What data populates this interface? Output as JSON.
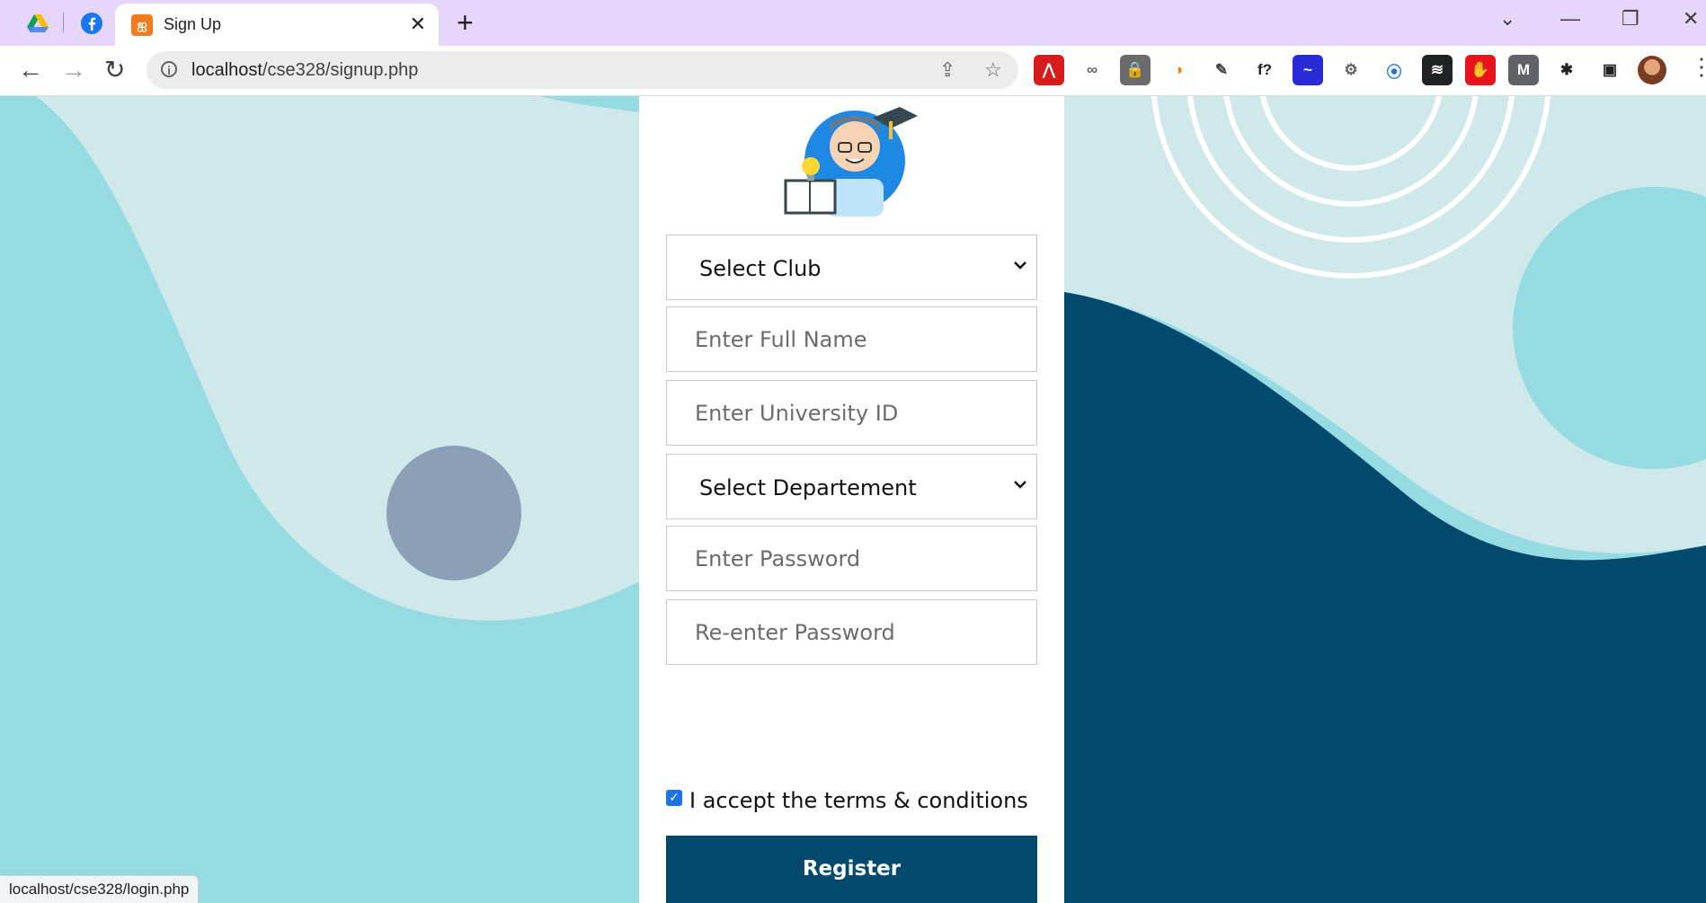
{
  "browser": {
    "tab_title": "Sign Up",
    "tab_close": "✕",
    "new_tab": "+",
    "url_host": "localhost",
    "url_path": "/cse328/signup.php",
    "status_url": "localhost/cse328/login.php",
    "pinned_tabs": [
      {
        "name": "google-drive-icon"
      },
      {
        "name": "facebook-icon"
      }
    ],
    "window_controls": [
      "⌄",
      "—",
      "❐",
      "✕"
    ],
    "extensions": [
      {
        "name": "adobe-acrobat-icon",
        "glyph": "⋀",
        "bg": "#d71c1c",
        "fg": "#ffffff"
      },
      {
        "name": "cycle-extension-icon",
        "glyph": "∞",
        "bg": "#ffffff",
        "fg": "#5f6368"
      },
      {
        "name": "lock-extension-icon",
        "glyph": "🔒",
        "bg": "#6b6b6b",
        "fg": "#ffffff"
      },
      {
        "name": "orange-extension-icon",
        "glyph": "◑",
        "bg": "#ffffff",
        "fg": "#f57c00"
      },
      {
        "name": "eyedropper-icon",
        "glyph": "✎",
        "bg": "#ffffff",
        "fg": "#3c4043"
      },
      {
        "name": "function-extension-icon",
        "glyph": "f?",
        "bg": "#ffffff",
        "fg": "#202124"
      },
      {
        "name": "chart-extension-icon",
        "glyph": "~",
        "bg": "#2a2bd8",
        "fg": "#ffffff"
      },
      {
        "name": "settings-extension-icon",
        "glyph": "⚙",
        "bg": "#ffffff",
        "fg": "#5f6368"
      },
      {
        "name": "screen-capture-icon",
        "glyph": "⦿",
        "bg": "#ffffff",
        "fg": "#1a73e8"
      },
      {
        "name": "pattern-extension-icon",
        "glyph": "≋",
        "bg": "#202124",
        "fg": "#ffffff"
      },
      {
        "name": "stop-hand-icon",
        "glyph": "✋",
        "bg": "#e8131b",
        "fg": "#ffffff"
      },
      {
        "name": "m-extension-icon",
        "glyph": "M",
        "bg": "#5f6368",
        "fg": "#ffffff"
      },
      {
        "name": "puzzle-extensions-icon",
        "glyph": "✱",
        "bg": "#ffffff",
        "fg": "#202124"
      },
      {
        "name": "side-panel-icon",
        "glyph": "▣",
        "bg": "#ffffff",
        "fg": "#202124"
      }
    ]
  },
  "form": {
    "club_select": "Select Club",
    "full_name_placeholder": "Enter Full Name",
    "university_id_placeholder": "Enter University ID",
    "department_select": "Select Departement",
    "password_placeholder": "Enter Password",
    "reenter_password_placeholder": "Re-enter Password",
    "terms_label": "I accept the terms & conditions",
    "terms_checked": true,
    "register_label": "Register"
  },
  "colors": {
    "page_bg": "#cfe9ea",
    "wave_light": "#96dbe2",
    "wave_dark": "#02496e",
    "circle": "#8fa1b8",
    "accent": "#02496e"
  }
}
